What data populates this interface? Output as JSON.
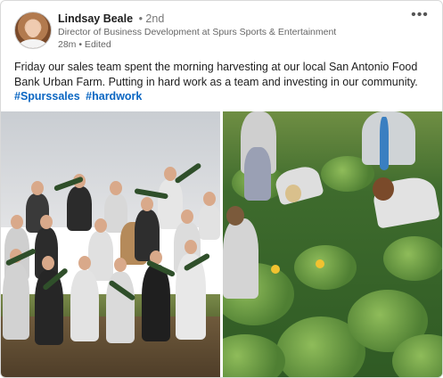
{
  "post": {
    "author": {
      "name": "Lindsay Beale",
      "degree": "• 2nd",
      "headline": "Director of Business Development at Spurs Sports & Entertainment",
      "meta": "28m • Edited"
    },
    "text": "Friday our sales team spent the morning harvesting at our local San Antonio Food Bank Urban Farm.  Putting in hard work as a team and investing in our community.",
    "hashtags": [
      "#Spurssales",
      "#hardwork"
    ],
    "more_icon": "more-horizontal-icon"
  },
  "colors": {
    "link": "#0a66c2",
    "text": "#1d1d1d",
    "muted": "#666666"
  }
}
